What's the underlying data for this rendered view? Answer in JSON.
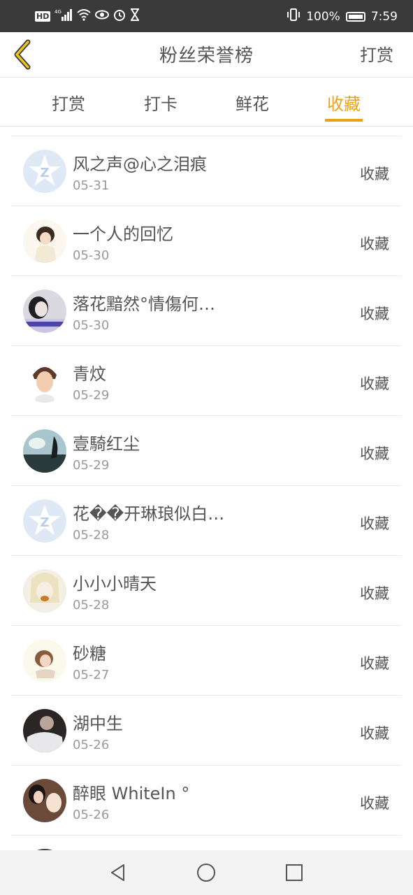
{
  "status_bar": {
    "left_network": "HD 4G",
    "battery_percent": "100%",
    "time": "7:59"
  },
  "header": {
    "title": "粉丝荣誉榜",
    "right_action": "打赏"
  },
  "tabs": [
    {
      "label": "打赏",
      "active": false
    },
    {
      "label": "打卡",
      "active": false
    },
    {
      "label": "鲜花",
      "active": false
    },
    {
      "label": "收藏",
      "active": true
    }
  ],
  "list": [
    {
      "name": "风之声@心之泪痕",
      "date": "05-31",
      "action": "收藏",
      "avatar": "default-avatar-icon"
    },
    {
      "name": "一个人的回忆",
      "date": "05-30",
      "action": "收藏",
      "avatar": "photo"
    },
    {
      "name": "落花黯然°情傷何…",
      "date": "05-30",
      "action": "收藏",
      "avatar": "photo"
    },
    {
      "name": "青炆",
      "date": "05-29",
      "action": "收藏",
      "avatar": "photo"
    },
    {
      "name": "壹騎红尘",
      "date": "05-29",
      "action": "收藏",
      "avatar": "photo"
    },
    {
      "name": "花��开琳琅似白…",
      "date": "05-28",
      "action": "收藏",
      "avatar": "default-avatar-icon"
    },
    {
      "name": "小小小晴天",
      "date": "05-28",
      "action": "收藏",
      "avatar": "photo"
    },
    {
      "name": "砂糖",
      "date": "05-27",
      "action": "收藏",
      "avatar": "photo"
    },
    {
      "name": "湖中生",
      "date": "05-26",
      "action": "收藏",
      "avatar": "photo"
    },
    {
      "name": "醉眼 WhiteIn °",
      "date": "05-26",
      "action": "收藏",
      "avatar": "photo"
    }
  ],
  "colors": {
    "accent": "#e8a31a",
    "text": "#555555",
    "subtext": "#9a9a9a"
  }
}
